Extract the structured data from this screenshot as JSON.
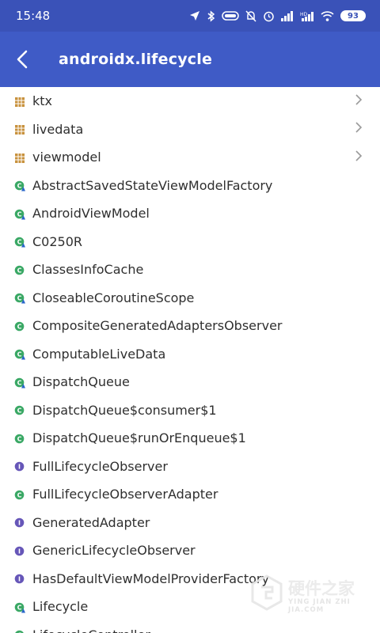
{
  "status_bar": {
    "time": "15:48",
    "battery": "93",
    "icons": [
      "location-icon",
      "bluetooth-icon",
      "vibrate-icon",
      "mute-icon",
      "alarm-icon",
      "signal-icon",
      "hd-signal-icon",
      "wifi-icon",
      "battery-icon"
    ]
  },
  "app_bar": {
    "title": "androidx.lifecycle"
  },
  "list": [
    {
      "label": "ktx",
      "type": "package",
      "chevron": true
    },
    {
      "label": "livedata",
      "type": "package",
      "chevron": true
    },
    {
      "label": "viewmodel",
      "type": "package",
      "chevron": true
    },
    {
      "label": "AbstractSavedStateViewModelFactory",
      "type": "class-abstract"
    },
    {
      "label": "AndroidViewModel",
      "type": "class-abstract"
    },
    {
      "label": "C0250R",
      "type": "class-abstract"
    },
    {
      "label": "ClassesInfoCache",
      "type": "class"
    },
    {
      "label": "CloseableCoroutineScope",
      "type": "class-abstract"
    },
    {
      "label": "CompositeGeneratedAdaptersObserver",
      "type": "class"
    },
    {
      "label": "ComputableLiveData",
      "type": "class-abstract"
    },
    {
      "label": "DispatchQueue",
      "type": "class-abstract"
    },
    {
      "label": "DispatchQueue$consumer$1",
      "type": "class"
    },
    {
      "label": "DispatchQueue$runOrEnqueue$1",
      "type": "class"
    },
    {
      "label": "FullLifecycleObserver",
      "type": "interface"
    },
    {
      "label": "FullLifecycleObserverAdapter",
      "type": "class"
    },
    {
      "label": "GeneratedAdapter",
      "type": "interface"
    },
    {
      "label": "GenericLifecycleObserver",
      "type": "interface"
    },
    {
      "label": "HasDefaultViewModelProviderFactory",
      "type": "interface"
    },
    {
      "label": "Lifecycle",
      "type": "class-abstract"
    },
    {
      "label": "LifecycleController",
      "type": "class-abstract"
    }
  ],
  "watermark": {
    "title": "硬件之家",
    "subtitle": "YING JIAN ZHI JIA.COM"
  },
  "colors": {
    "status_bar": "#3a52b8",
    "app_bar": "#3f5bc6",
    "package_icon": "#c8923e",
    "class_icon": "#3aa865",
    "interface_icon": "#6656b8",
    "abstract_badge": "#2a66c9"
  }
}
